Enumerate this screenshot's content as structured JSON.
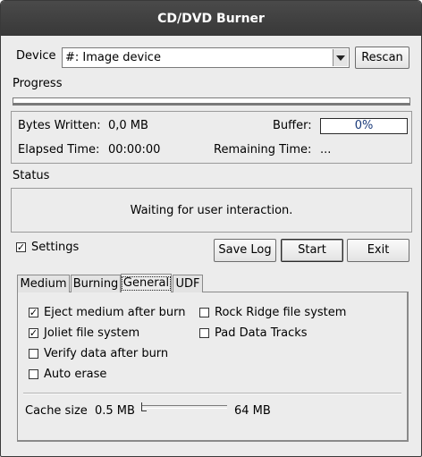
{
  "window": {
    "title": "CD/DVD Burner"
  },
  "device": {
    "label": "Device",
    "selected": "#: Image device",
    "rescan_label": "Rescan"
  },
  "progress": {
    "label": "Progress",
    "value": 0
  },
  "stats": {
    "bytes_written_label": "Bytes Written:",
    "bytes_written_value": "0,0 MB",
    "buffer_label": "Buffer:",
    "buffer_value": "0%",
    "elapsed_label": "Elapsed Time:",
    "elapsed_value": "00:00:00",
    "remaining_label": "Remaining Time:",
    "remaining_value": "..."
  },
  "status": {
    "label": "Status",
    "message": "Waiting for user interaction."
  },
  "settings": {
    "label": "Settings",
    "checked": true
  },
  "buttons": {
    "save_log": "Save Log",
    "start": "Start",
    "exit": "Exit"
  },
  "tabs": [
    {
      "label": "Medium",
      "active": false
    },
    {
      "label": "Burning",
      "active": false
    },
    {
      "label": "General",
      "active": true
    },
    {
      "label": "UDF",
      "active": false
    }
  ],
  "general": {
    "options": [
      {
        "label": "Eject medium after burn",
        "checked": true
      },
      {
        "label": "Joliet file system",
        "checked": true
      },
      {
        "label": "Verify data after burn",
        "checked": false
      },
      {
        "label": "Auto erase",
        "checked": false
      },
      {
        "label": "Rock Ridge file system",
        "checked": false
      },
      {
        "label": "Pad Data Tracks",
        "checked": false
      }
    ],
    "cache": {
      "label": "Cache size",
      "min_label": "0.5 MB",
      "max_label": "64 MB",
      "value_fraction": 0
    }
  },
  "icons": {
    "check": "check-mark",
    "dropdown": "chevron-down-icon"
  }
}
